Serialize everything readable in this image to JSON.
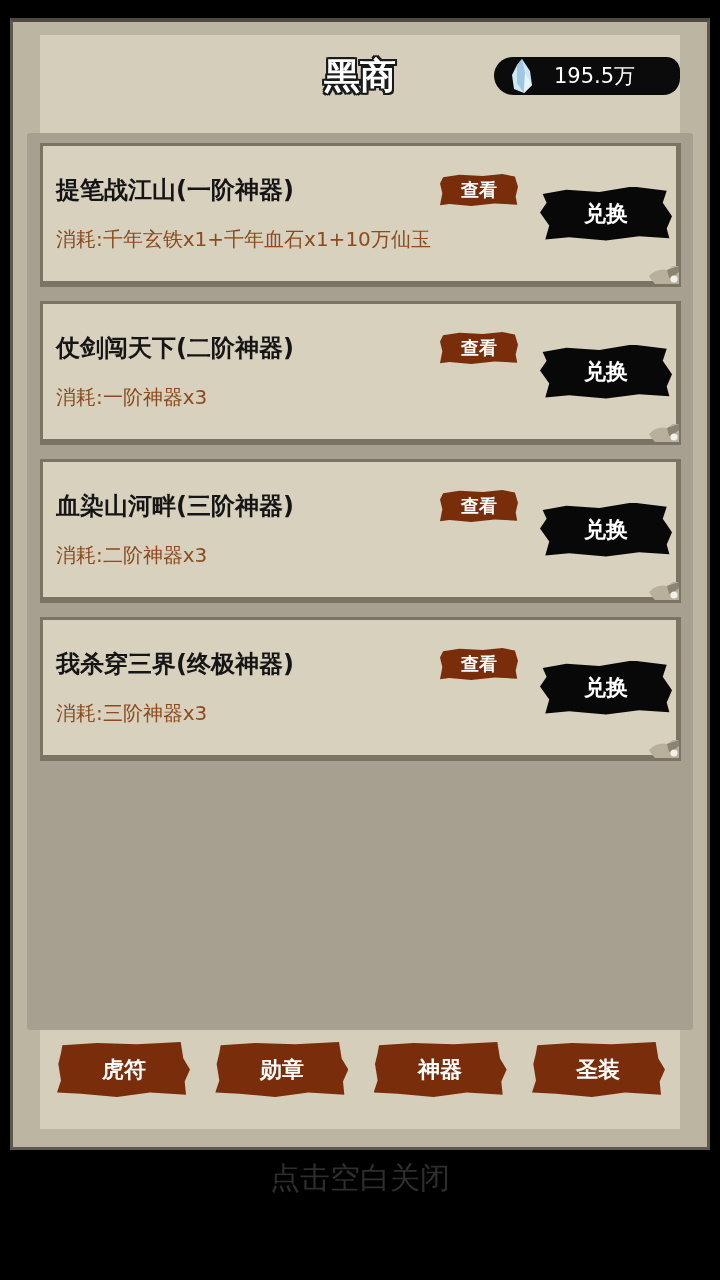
{
  "header": {
    "title": "黑商",
    "currency": {
      "amount": "195.5万"
    }
  },
  "items": [
    {
      "name": "提笔战江山(一阶神器)",
      "view_button": "查看",
      "cost": "消耗:千年玄铁x1+千年血石x1+10万仙玉",
      "exchange_button": "兑换"
    },
    {
      "name": "仗剑闯天下(二阶神器)",
      "view_button": "查看",
      "cost": "消耗:一阶神器x3",
      "exchange_button": "兑换"
    },
    {
      "name": "血染山河畔(三阶神器)",
      "view_button": "查看",
      "cost": "消耗:二阶神器x3",
      "exchange_button": "兑换"
    },
    {
      "name": "我杀穿三界(终极神器)",
      "view_button": "查看",
      "cost": "消耗:三阶神器x3",
      "exchange_button": "兑换"
    }
  ],
  "tabs": [
    {
      "label": "虎符"
    },
    {
      "label": "勋章"
    },
    {
      "label": "神器"
    },
    {
      "label": "圣装"
    }
  ],
  "close_hint": "点击空白关闭"
}
